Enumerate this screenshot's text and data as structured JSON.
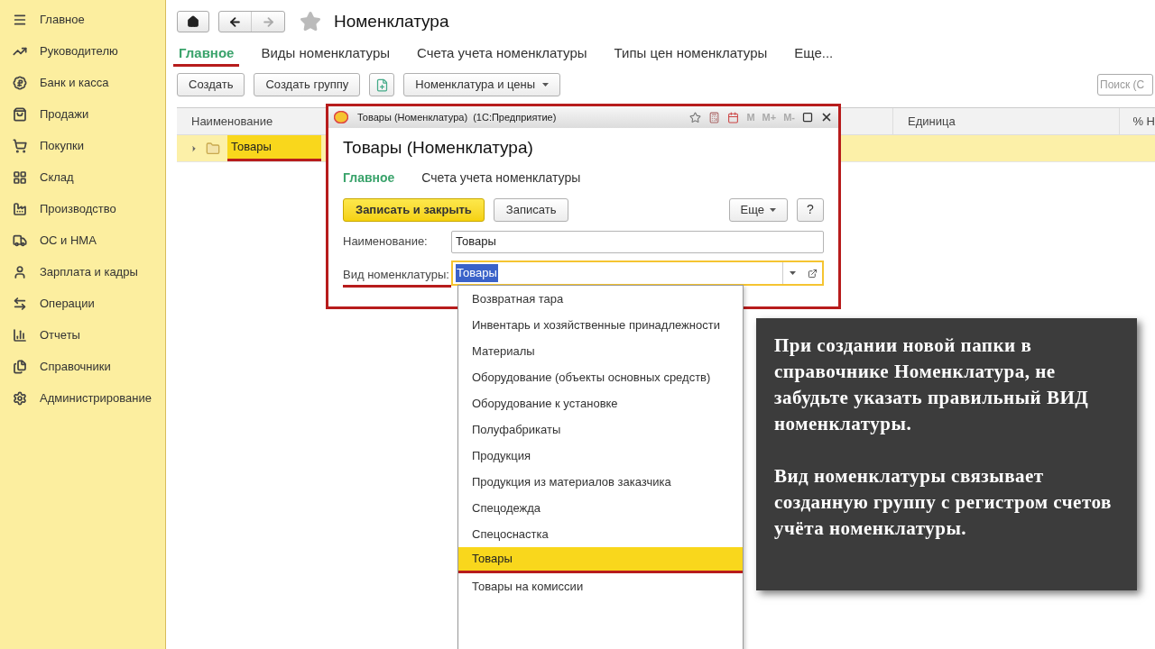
{
  "sidebar": {
    "items": [
      {
        "label": "Главное"
      },
      {
        "label": "Руководителю"
      },
      {
        "label": "Банк и касса"
      },
      {
        "label": "Продажи"
      },
      {
        "label": "Покупки"
      },
      {
        "label": "Склад"
      },
      {
        "label": "Производство"
      },
      {
        "label": "ОС и НМА"
      },
      {
        "label": "Зарплата и кадры"
      },
      {
        "label": "Операции"
      },
      {
        "label": "Отчеты"
      },
      {
        "label": "Справочники"
      },
      {
        "label": "Администрирование"
      }
    ]
  },
  "header": {
    "title": "Номенклатура"
  },
  "tabs": [
    {
      "label": "Главное",
      "selected": true
    },
    {
      "label": "Виды номенклатуры",
      "selected": false
    },
    {
      "label": "Счета учета номенклатуры",
      "selected": false
    },
    {
      "label": "Типы цен номенклатуры",
      "selected": false
    },
    {
      "label": "Еще...",
      "selected": false
    }
  ],
  "toolbar": {
    "buttons": [
      "Создать",
      "Создать группу"
    ],
    "menu_button": "Номенклатура и цены",
    "search": {
      "placeholder": "Поиск (С"
    }
  },
  "table": {
    "columns": [
      "Наименование",
      "Единица",
      "% Н"
    ],
    "rows": [
      {
        "name": "Товары",
        "selected": true
      }
    ]
  },
  "dialog": {
    "window_title": "Товары (Номенклатура)  (1С:Предприятие)",
    "memory_buttons": [
      "M",
      "M+",
      "M-"
    ],
    "heading": "Товары (Номенклатура)",
    "tabs": [
      {
        "label": "Главное",
        "selected": true
      },
      {
        "label": "Счета учета номенклатуры",
        "selected": false
      }
    ],
    "primary_button": "Записать и закрыть",
    "secondary_button": "Записать",
    "more_button": "Еще",
    "help_button": "?",
    "fields": [
      {
        "label": "Наименование:",
        "value": "Товары",
        "focused": false
      },
      {
        "label": "Вид номенклатуры:",
        "value": "Товары",
        "focused": true
      }
    ]
  },
  "dropdown": {
    "items": [
      {
        "label": "Возвратная тара",
        "selected": false
      },
      {
        "label": "Инвентарь и хозяйственные принадлежности",
        "selected": false
      },
      {
        "label": "Материалы",
        "selected": false
      },
      {
        "label": "Оборудование (объекты основных средств)",
        "selected": false
      },
      {
        "label": "Оборудование к установке",
        "selected": false
      },
      {
        "label": "Полуфабрикаты",
        "selected": false
      },
      {
        "label": "Продукция",
        "selected": false
      },
      {
        "label": "Продукция из материалов заказчика",
        "selected": false
      },
      {
        "label": "Спецодежда",
        "selected": false
      },
      {
        "label": "Спецоснастка",
        "selected": false
      },
      {
        "label": "Товары",
        "selected": true
      },
      {
        "label": "Товары на комиссии",
        "selected": false
      }
    ]
  },
  "callout": {
    "paragraphs": [
      "При создании новой папки в справочнике Номенклатура, не забудьте указать правильный ВИД номенклатуры.",
      "Вид номенклатуры связывает созданную группу с регистром счетов учёта номенклатуры."
    ]
  }
}
